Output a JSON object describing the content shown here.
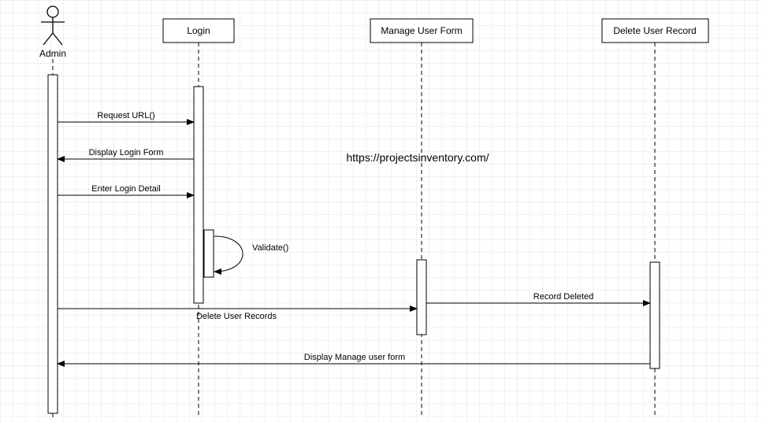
{
  "actor": {
    "label": "Admin"
  },
  "lifelines": {
    "login": {
      "label": "Login"
    },
    "manage": {
      "label": "Manage User Form"
    },
    "delete": {
      "label": "Delete User Record"
    }
  },
  "messages": {
    "m1": "Request URL()",
    "m2": "Display Login Form",
    "m3": "Enter Login Detail",
    "m4": "Validate()",
    "m5": "Delete User Records",
    "m6": "Record Deleted",
    "m7": "Display Manage user form"
  },
  "watermark": "https://projectsinventory.com/"
}
